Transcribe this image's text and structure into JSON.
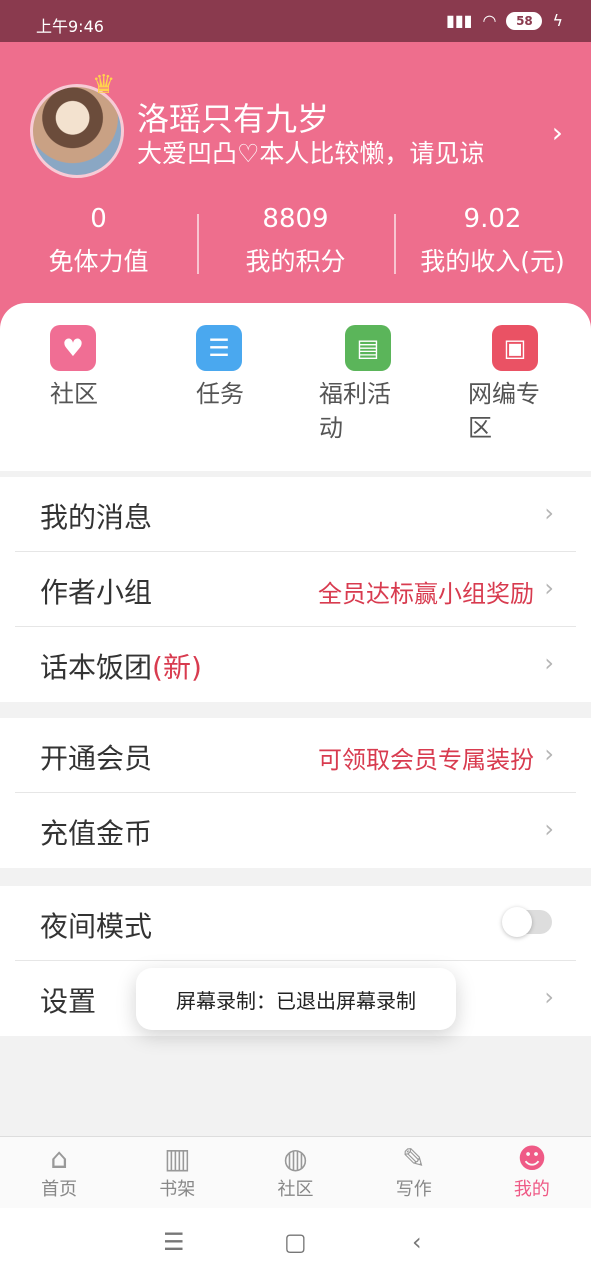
{
  "status": {
    "time": "上午9:46",
    "battery": "58"
  },
  "profile": {
    "name": "洛瑶只有九岁",
    "signature": "大爱凹凸♡本人比较懒，请见谅"
  },
  "stats": [
    {
      "value": "0",
      "label": "免体力值"
    },
    {
      "value": "8809",
      "label": "我的积分"
    },
    {
      "value": "9.02",
      "label": "我的收入(元)"
    }
  ],
  "quick": [
    {
      "label": "社区",
      "color": "#f06e94",
      "icon": "heart-envelope-icon"
    },
    {
      "label": "任务",
      "color": "#4aa8ef",
      "icon": "notepad-icon"
    },
    {
      "label": "福利活动",
      "color": "#5bb55a",
      "icon": "newspaper-icon"
    },
    {
      "label": "网编专区",
      "color": "#ea5264",
      "icon": "gift-icon"
    }
  ],
  "menu": {
    "messages": "我的消息",
    "author_group": "作者小组",
    "author_group_hint": "全员达标赢小组奖励",
    "fan_group": "话本饭团",
    "fan_group_new": "(新)",
    "vip": "开通会员",
    "vip_hint": "可领取会员专属装扮",
    "recharge": "充值金币",
    "night_mode": "夜间模式",
    "settings": "设置"
  },
  "toast": "屏幕录制：已退出屏幕录制",
  "tabs": [
    {
      "label": "首页",
      "icon": "home-icon"
    },
    {
      "label": "书架",
      "icon": "bookshelf-icon"
    },
    {
      "label": "社区",
      "icon": "planet-icon"
    },
    {
      "label": "写作",
      "icon": "pen-icon"
    },
    {
      "label": "我的",
      "icon": "profile-icon"
    }
  ],
  "colors": {
    "header": "#ee6e8d",
    "accent_red": "#d83b4f",
    "active_tab": "#ef5a86"
  }
}
